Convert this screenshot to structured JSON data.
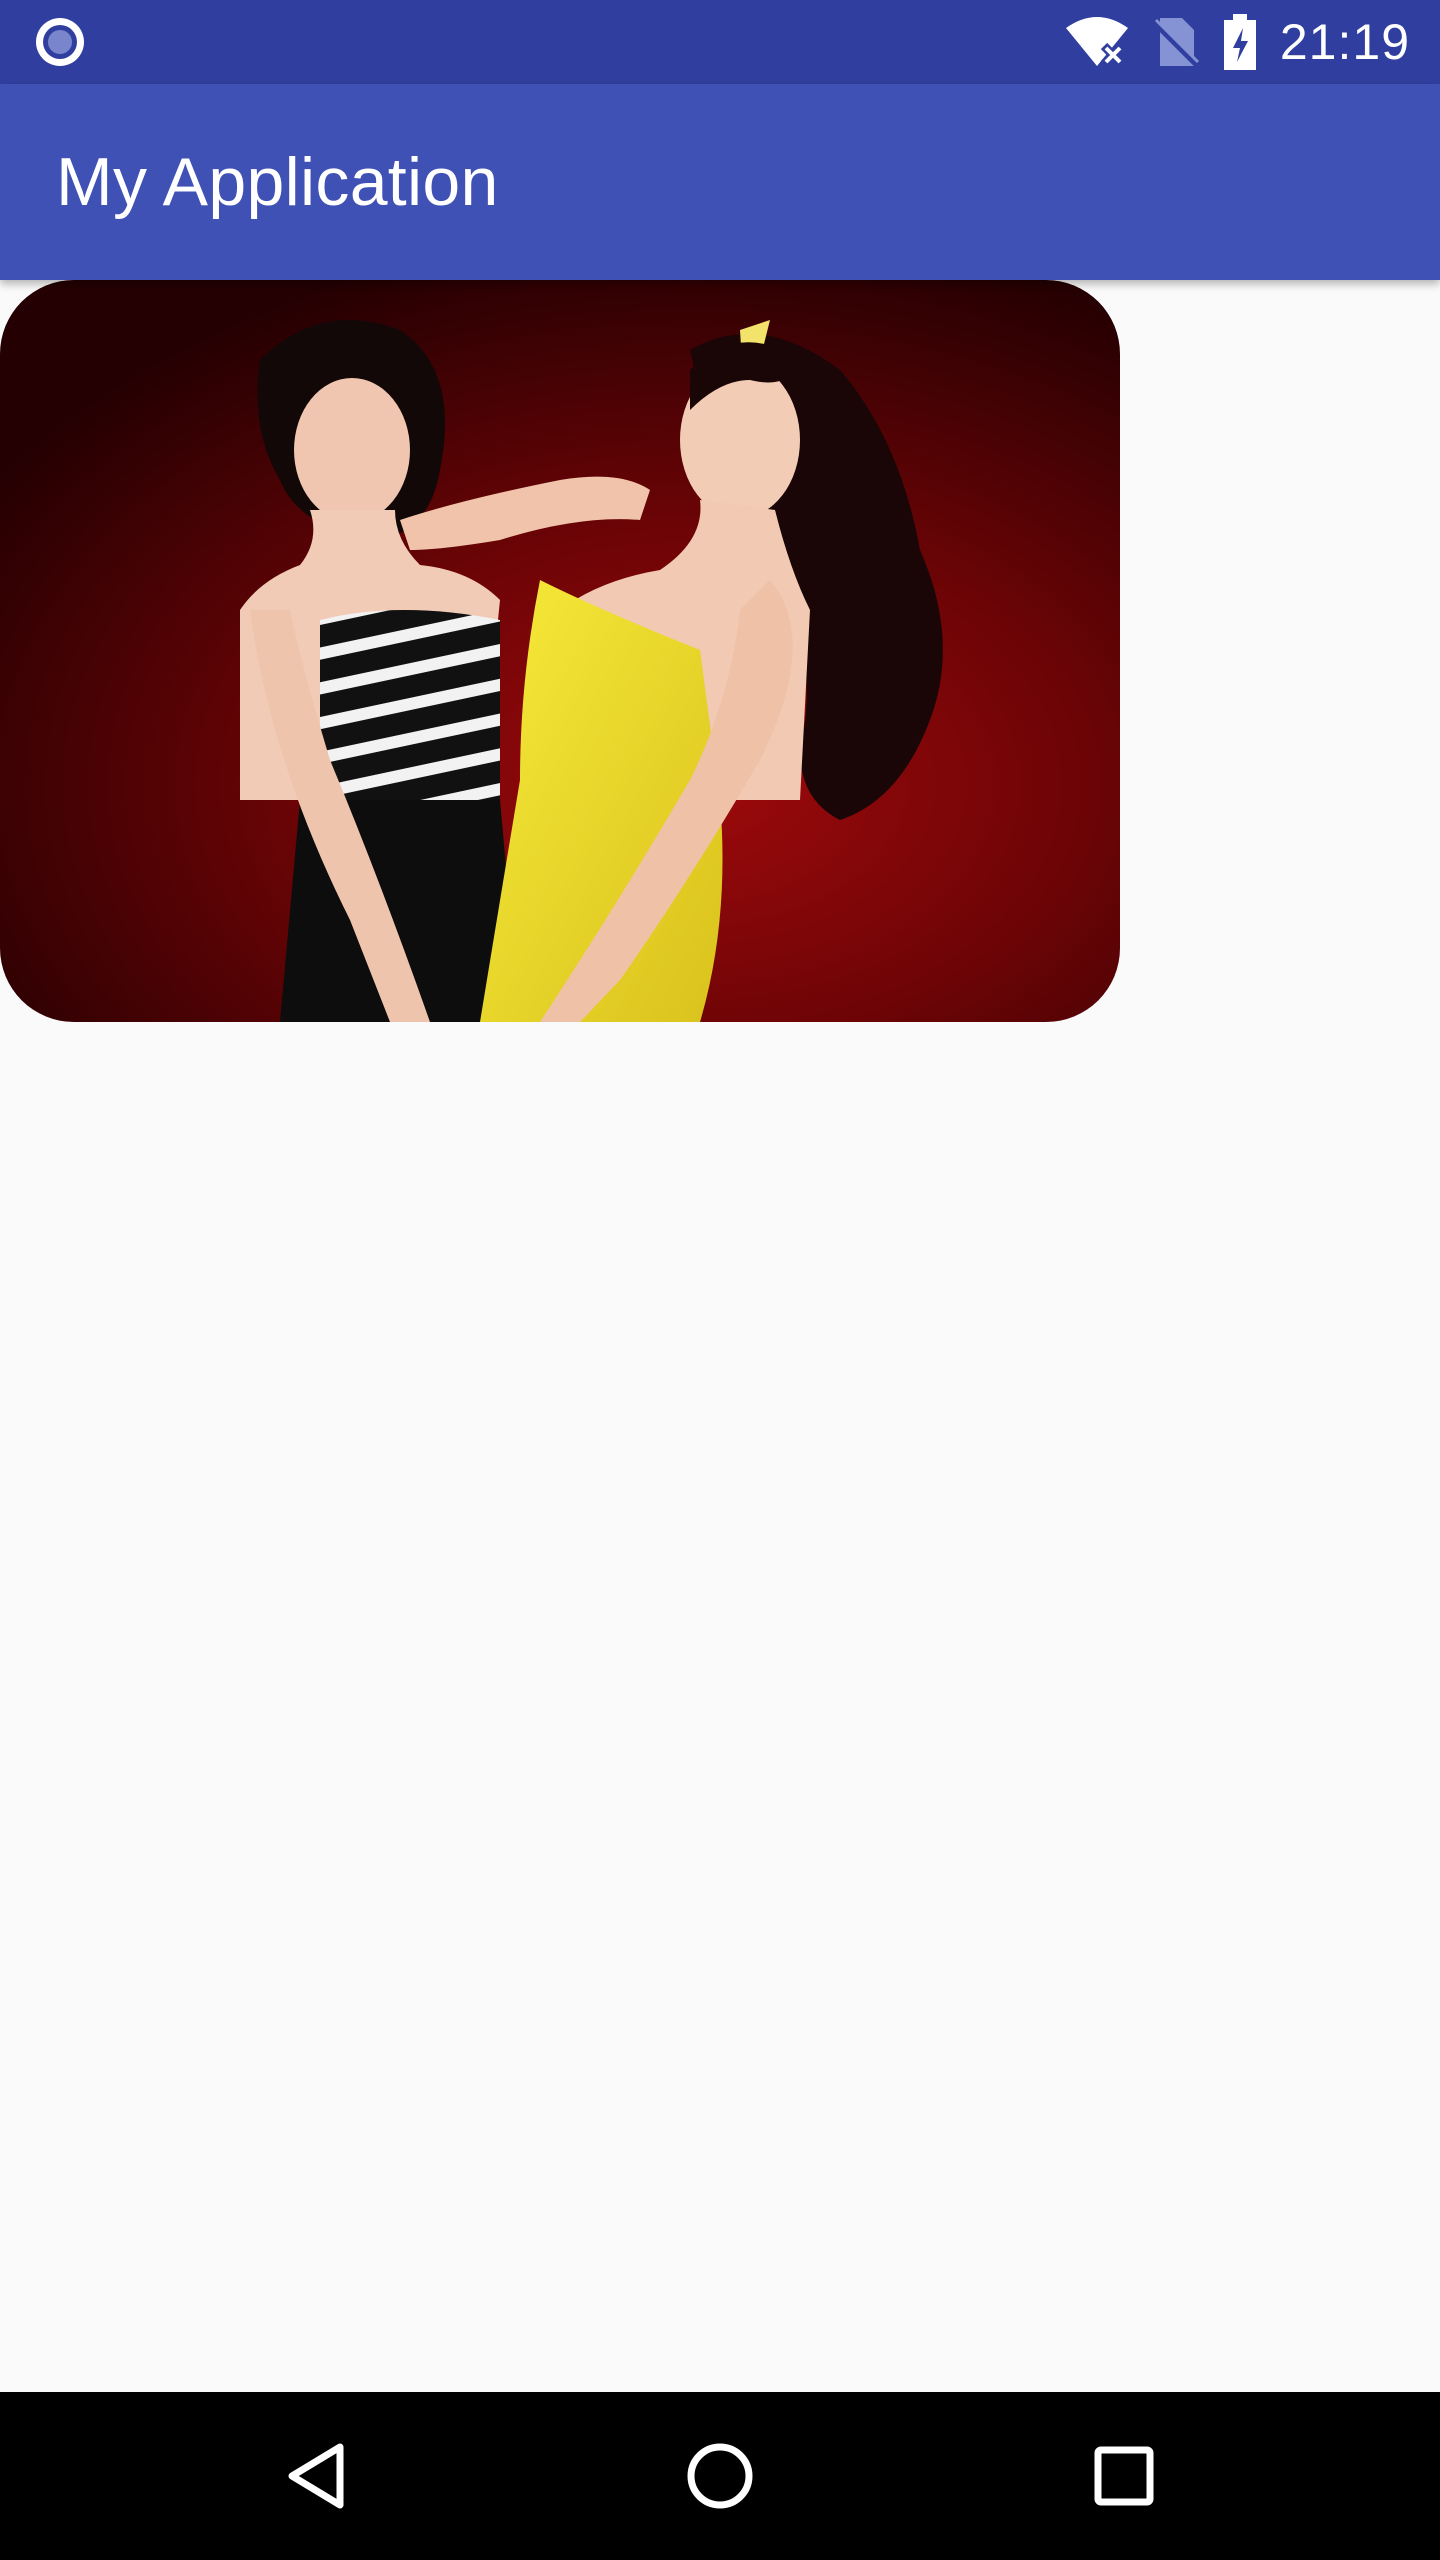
{
  "status_bar": {
    "time": "21:19",
    "left_icon": "notification-dot-icon",
    "icons": [
      "wifi-off-icon",
      "no-sim-icon",
      "battery-charging-icon"
    ]
  },
  "app_bar": {
    "title": "My Application"
  },
  "photo": {
    "description_icon": "photo-image"
  },
  "nav": {
    "icons": [
      "back-triangle-icon",
      "home-circle-icon",
      "recents-square-icon"
    ]
  },
  "colors": {
    "status_bar": "#303f9f",
    "app_bar": "#3f51b5",
    "background": "#fafafa",
    "nav_bar": "#000000"
  }
}
